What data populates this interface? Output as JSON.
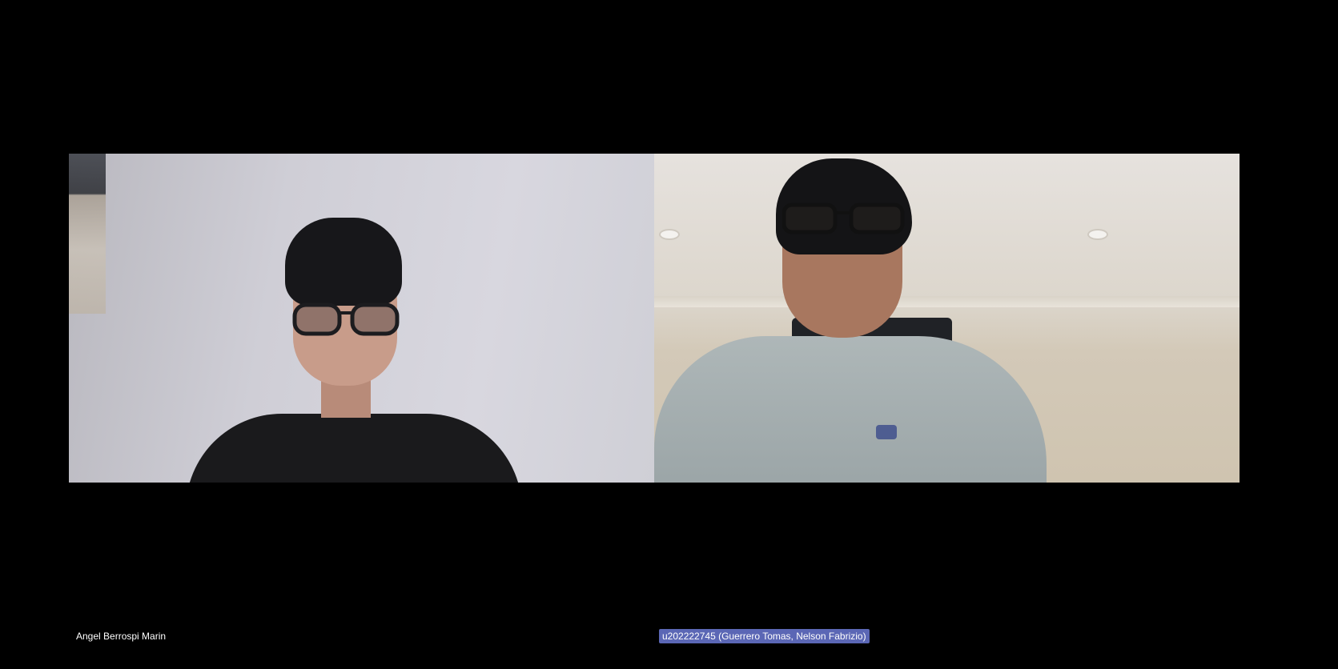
{
  "participants": [
    {
      "name": "Angel Berrospi Marin",
      "highlighted": false
    },
    {
      "name": "u202222745 (Guerrero Tomas, Nelson Fabrizio)",
      "highlighted": true,
      "highlight_color": "#5b67b5"
    }
  ],
  "colors": {
    "background": "#000000",
    "label_text": "#ffffff"
  }
}
